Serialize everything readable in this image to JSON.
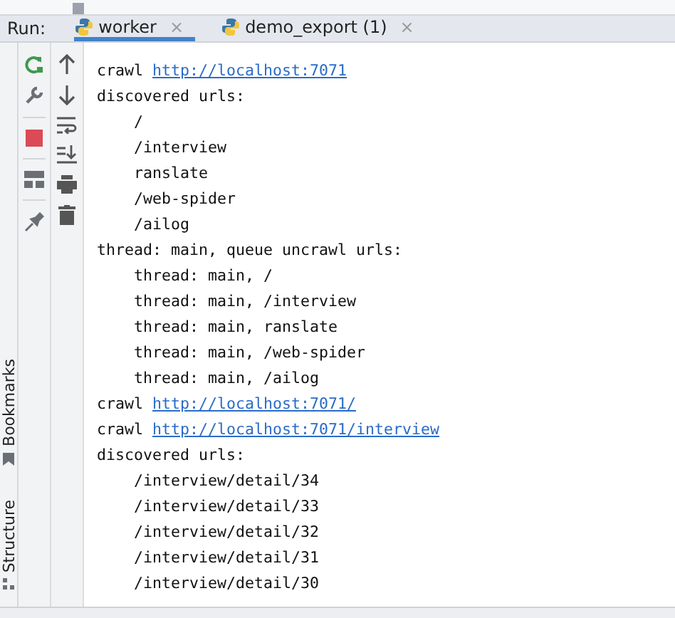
{
  "run_panel": {
    "label": "Run:",
    "tabs": [
      {
        "label": "worker",
        "selected": true,
        "close": "×"
      },
      {
        "label": "demo_export (1)",
        "selected": false,
        "close": "×"
      }
    ]
  },
  "side_tool_windows": [
    {
      "label": "Bookmarks",
      "kind": "bookmarks"
    },
    {
      "label": "Structure",
      "kind": "structure"
    }
  ],
  "console": {
    "lines": [
      {
        "text": "crawl ",
        "link": "http://localhost:7071"
      },
      {
        "text": "discovered urls:"
      },
      {
        "text": "    /"
      },
      {
        "text": "    /interview"
      },
      {
        "text": "    ranslate"
      },
      {
        "text": "    /web-spider"
      },
      {
        "text": "    /ailog"
      },
      {
        "text": "thread: main, queue uncrawl urls:"
      },
      {
        "text": "    thread: main, /"
      },
      {
        "text": "    thread: main, /interview"
      },
      {
        "text": "    thread: main, ranslate"
      },
      {
        "text": "    thread: main, /web-spider"
      },
      {
        "text": "    thread: main, /ailog"
      },
      {
        "text": "crawl ",
        "link": "http://localhost:7071/"
      },
      {
        "text": "crawl ",
        "link": "http://localhost:7071/interview"
      },
      {
        "text": "discovered urls:"
      },
      {
        "text": "    /interview/detail/34"
      },
      {
        "text": "    /interview/detail/33"
      },
      {
        "text": "    /interview/detail/32"
      },
      {
        "text": "    /interview/detail/31"
      },
      {
        "text": "    /interview/detail/30"
      }
    ]
  }
}
